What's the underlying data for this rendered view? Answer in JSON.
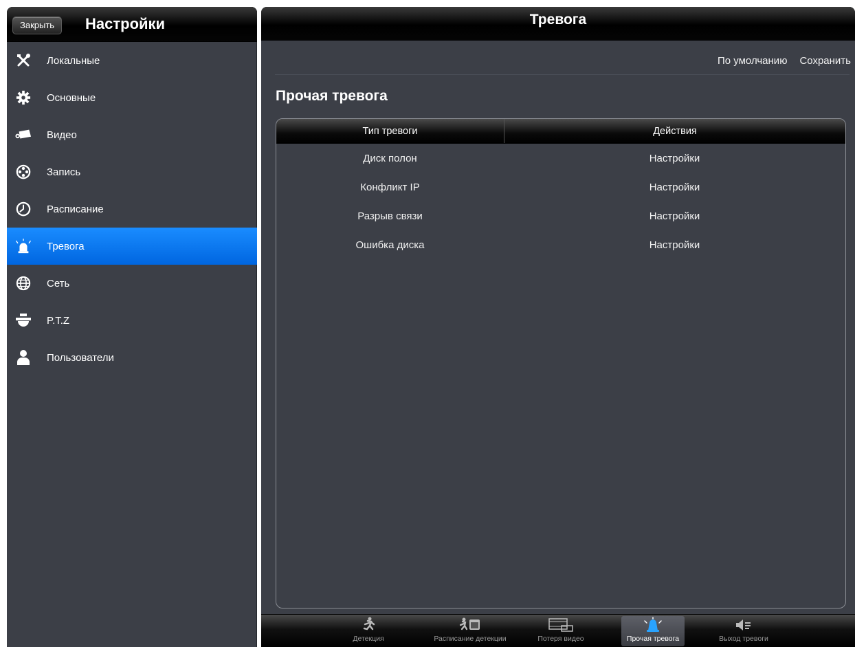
{
  "left": {
    "close_label": "Закрыть",
    "title": "Настройки",
    "items": [
      {
        "label": "Локальные",
        "icon": "tools-icon"
      },
      {
        "label": "Основные",
        "icon": "gear-icon"
      },
      {
        "label": "Видео",
        "icon": "camera-icon"
      },
      {
        "label": "Запись",
        "icon": "film-reel-icon"
      },
      {
        "label": "Расписание",
        "icon": "clock-icon"
      },
      {
        "label": "Тревога",
        "icon": "alarm-icon",
        "active": true
      },
      {
        "label": "Сеть",
        "icon": "globe-icon"
      },
      {
        "label": "P.T.Z",
        "icon": "dome-camera-icon"
      },
      {
        "label": "Пользователи",
        "icon": "user-icon"
      }
    ]
  },
  "right": {
    "title": "Тревога",
    "toolbar": {
      "default_label": "По умолчанию",
      "save_label": "Сохранить"
    },
    "section_title": "Прочая тревога",
    "table": {
      "headers": [
        "Тип тревоги",
        "Действия"
      ],
      "rows": [
        {
          "type": "Диск полон",
          "action": "Настройки"
        },
        {
          "type": "Конфликт IP",
          "action": "Настройки"
        },
        {
          "type": "Разрыв связи",
          "action": "Настройки"
        },
        {
          "type": "Ошибка диска",
          "action": "Настройки"
        }
      ]
    },
    "tabs": [
      {
        "label": "Детекция",
        "icon": "running-man-icon"
      },
      {
        "label": "Расписание детекции",
        "icon": "schedule-detection-icon"
      },
      {
        "label": "Потеря видео",
        "icon": "film-strip-icon"
      },
      {
        "label": "Прочая тревога",
        "icon": "alarm-bell-icon",
        "active": true
      },
      {
        "label": "Выход тревоги",
        "icon": "speaker-output-icon"
      }
    ]
  },
  "colors": {
    "panel_bg": "#3c3f47",
    "active_blue": "#0a7bf5",
    "header_black": "#000000"
  }
}
